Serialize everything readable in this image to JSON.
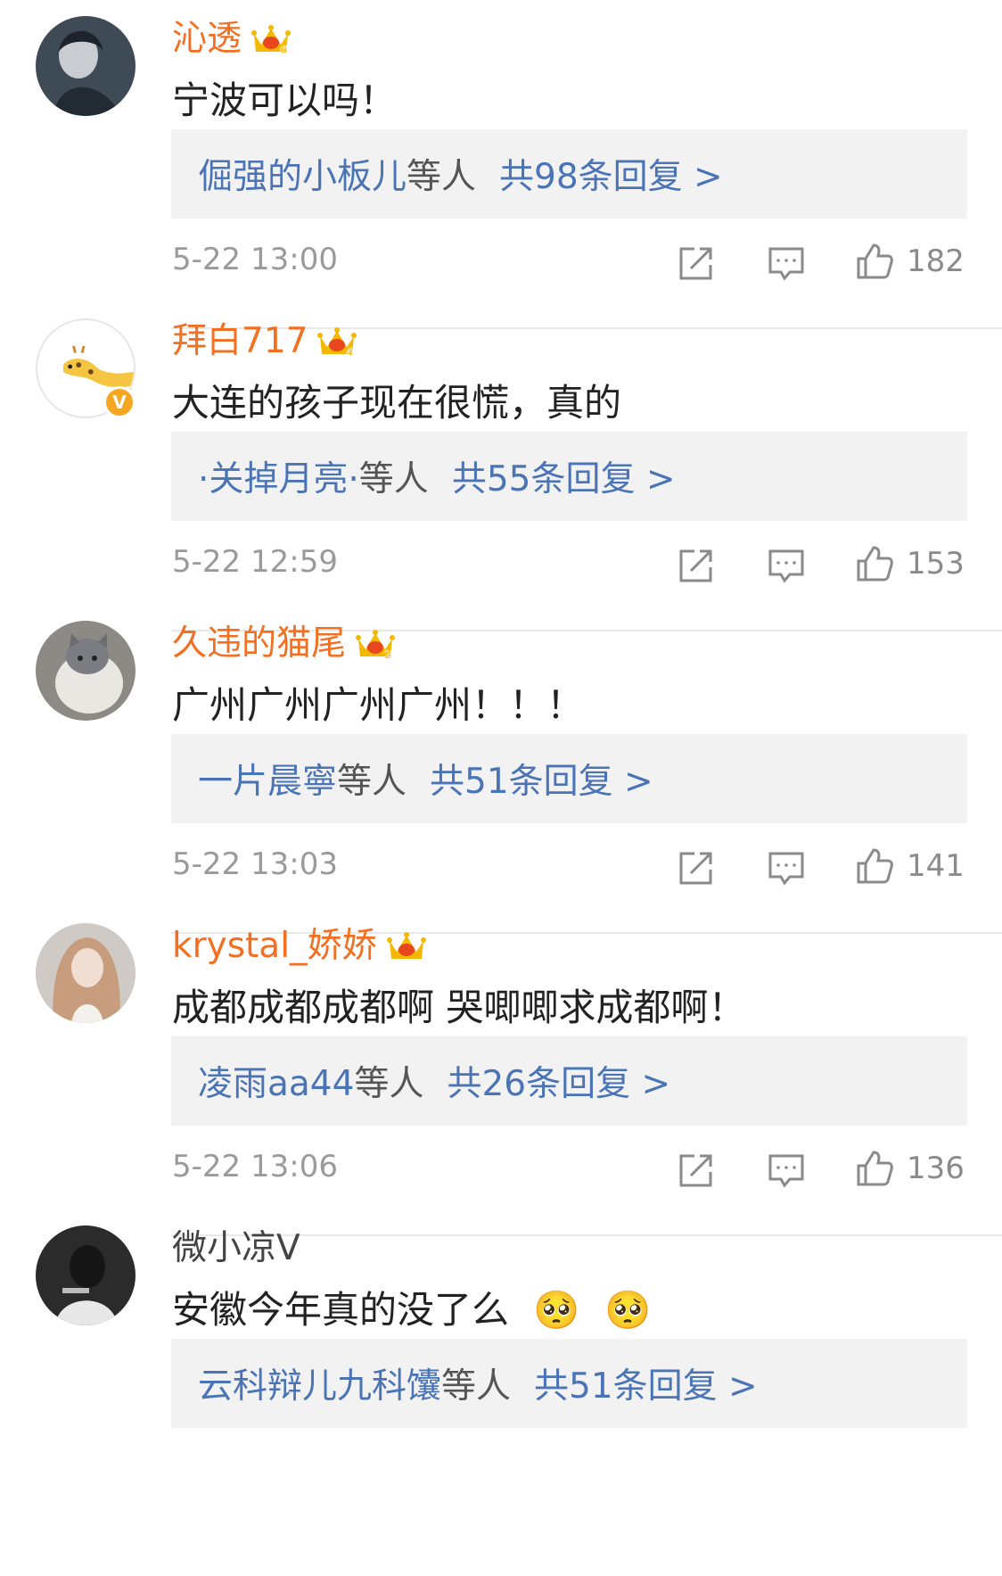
{
  "colors": {
    "username_accent": "#f36f21",
    "link_blue": "#4a74b5",
    "timestamp_gray": "#9a9a9a",
    "reply_box_bg": "#f2f2f2",
    "crown_gold": "#f5b800",
    "crown_red": "#e8471d",
    "verified_badge": "#f5a623"
  },
  "icons": {
    "forward": "share-square-arrow-icon",
    "comment": "speech-bubble-dots-icon",
    "like": "thumbs-up-icon",
    "member": "crown-icon"
  },
  "comments": [
    {
      "username": "沁透",
      "member_crown": true,
      "crown_level": "6",
      "verified": false,
      "text": "宁波可以吗！",
      "reply_users": "倔强的小板儿",
      "reply_suffix": "等人",
      "reply_count": "共98条回复 >",
      "time": "5-22 13:00",
      "likes": "182"
    },
    {
      "username": "拜白717",
      "member_crown": true,
      "crown_level": "4",
      "verified": true,
      "verified_mark": "V",
      "text": "大连的孩子现在很慌，真的",
      "reply_users": "·关掉月亮·",
      "reply_suffix": "等人",
      "reply_count": "共55条回复 >",
      "time": "5-22 12:59",
      "likes": "153"
    },
    {
      "username": "久违的猫尾",
      "member_crown": true,
      "crown_level": "2",
      "verified": false,
      "text": "广州广州广州广州！！！",
      "reply_users": "一片晨寧",
      "reply_suffix": "等人",
      "reply_count": "共51条回复 >",
      "time": "5-22 13:03",
      "likes": "141"
    },
    {
      "username": "krystal_娇娇",
      "member_crown": true,
      "crown_level": "",
      "verified": false,
      "text": "成都成都成都啊 哭唧唧求成都啊！",
      "reply_users": "凌雨aa44",
      "reply_suffix": "等人",
      "reply_count": "共26条回复 >",
      "time": "5-22 13:06",
      "likes": "136"
    },
    {
      "username": "微小凉V",
      "member_crown": false,
      "verified": false,
      "text": "安徽今年真的没了么",
      "emoji": "🥺",
      "reply_users": "云科辩儿九科馕",
      "reply_suffix": "等人",
      "reply_count": "共51条回复 >"
    }
  ]
}
